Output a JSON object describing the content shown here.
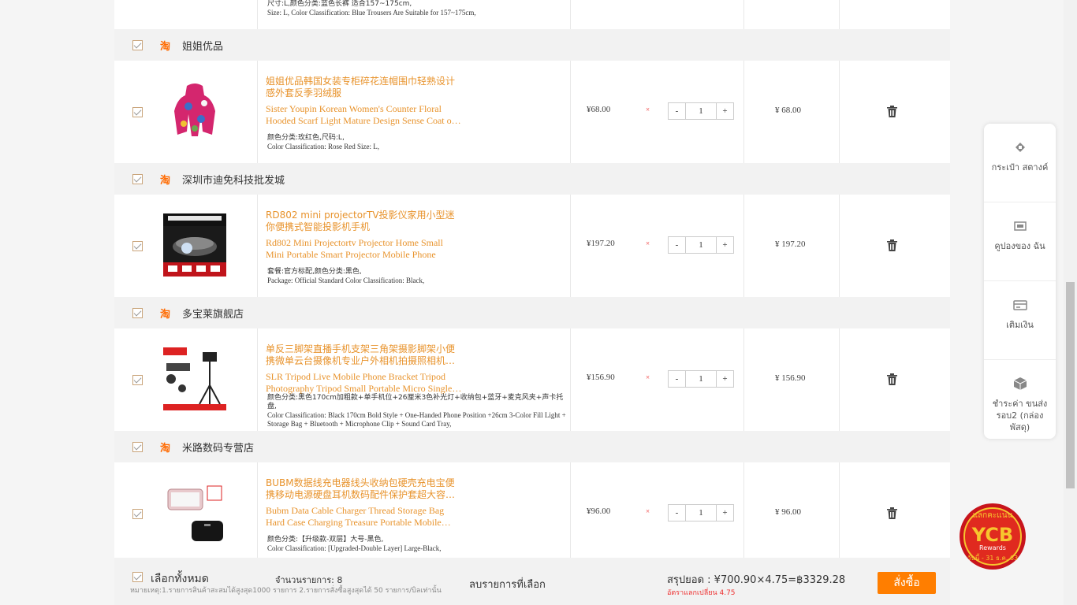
{
  "top_partial": {
    "spec_cn": "尺寸:L,颜色分类:蓝色长裤 适合157~175cm,",
    "spec_en": "Size: L, Color Classification: Blue Trousers Are Suitable for 157~175cm,"
  },
  "shops": [
    {
      "name": "姐姐优品",
      "logo": "淘",
      "item": {
        "title_cn": "姐姐优品韩国女装专柜碎花连帽围巾轻熟设计感外套反季羽绒服",
        "title_en": "Sister Youpin Korean Women's Counter Floral Hooded Scarf Light Mature Design Sense Coat o…",
        "spec_cn": "颜色分类:玫红色,尺码:L,",
        "spec_en": "Color Classification: Rose Red Size: L,",
        "price": "¥68.00",
        "qty": "1",
        "total": "¥ 68.00"
      }
    },
    {
      "name": "深圳市迪免科技批发城",
      "logo": "淘",
      "item": {
        "title_cn": "RD802 mini projectorTV投影仪家用小型迷你便携式智能投影机手机",
        "title_en": "Rd802 Mini Projectortv Projector Home Small Mini Portable Smart Projector Mobile Phone",
        "spec_cn": "套餐:官方标配,颜色分类:黑色,",
        "spec_en": "Package: Official Standard Color Classification: Black,",
        "price": "¥197.20",
        "qty": "1",
        "total": "¥ 197.20"
      }
    },
    {
      "name": "多宝莱旗舰店",
      "logo": "淘",
      "item": {
        "title_cn": "单反三脚架直播手机支架三角架摄影脚架小便携微单云台摄像机专业户外相机拍摄照相机…",
        "title_en": "SLR Tripod Live Mobile Phone Bracket Tripod Photography Tripod Small Portable Micro Single…",
        "spec_cn": "颜色分类:黑色170cm加粗款+单手机位+26厘米3色补光灯+收纳包+蓝牙+麦克风夹+声卡托盘,",
        "spec_en": "Color Classification: Black 170cm Bold Style + One-Handed Phone Position +26cm 3-Color Fill Light + Storage Bag + Bluetooth + Microphone Clip + Sound Card Tray,",
        "price": "¥156.90",
        "qty": "1",
        "total": "¥ 156.90"
      }
    },
    {
      "name": "米路数码专营店",
      "logo": "淘",
      "item": {
        "title_cn": "BUBM数据线充电器线头收纳包硬壳充电宝便携移动电源硬盘耳机数码配件保护套超大容…",
        "title_en": "Bubm Data Cable Charger Thread Storage Bag Hard Case Charging Treasure Portable Mobile…",
        "spec_cn": "颜色分类:【升级款-双层】大号-黑色,",
        "spec_en": "Color Classification: [Upgraded-Double Layer] Large-Black,",
        "price": "¥96.00",
        "qty": "1",
        "total": "¥ 96.00"
      }
    }
  ],
  "stepper": {
    "minus": "-",
    "plus": "+",
    "times": "×"
  },
  "footer": {
    "select_all": "เลือกทั้งหมด",
    "note": "หมายเหตุ:1.รายการสินค้าสะสมได้สูงสุด1000 รายการ 2.รายการสั่งซื้อสูงสุดได้ 50 รายการ/บิลเท่านั้น",
    "count": "จำนวนรายการ:  8",
    "delete_selected": "ลบรายการที่เลือก",
    "summary": "สรุปยอด :  ¥700.90×4.75=฿3329.28",
    "rate": "อัตราแลกเปลี่ยน 4.75",
    "order_button": "สั่งซื้อ"
  },
  "sidebar": [
    {
      "label": "กระเป๋า สตางค์",
      "icon": "wallet-icon"
    },
    {
      "label": "คูปองของ ฉัน",
      "icon": "coupon-icon"
    },
    {
      "label": "เติมเงิน",
      "icon": "topup-icon"
    },
    {
      "label": "ชำระค่า ขนส่ง รอบ2 (กล่องพัสดุ)",
      "icon": "box-icon"
    }
  ],
  "badge": {
    "top": "แลกคะแนน",
    "main": "YCB",
    "sub": "Rewards",
    "bottom": "วันนี้ - 31 ธ.ค. 63"
  }
}
